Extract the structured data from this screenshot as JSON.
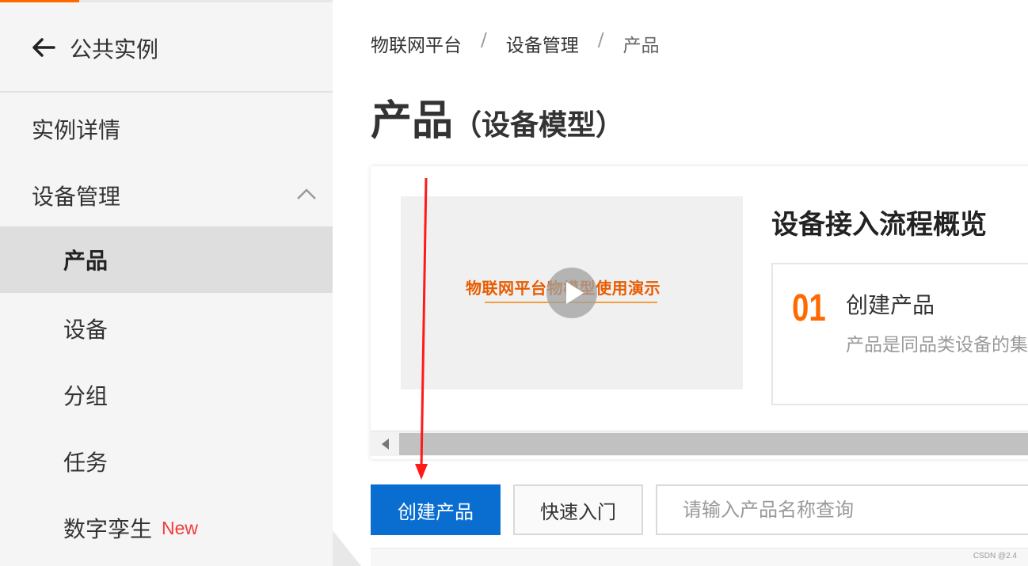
{
  "sidebar": {
    "title": "公共实例",
    "items": [
      {
        "label": "实例详情"
      },
      {
        "label": "设备管理"
      },
      {
        "label": "产品"
      },
      {
        "label": "设备"
      },
      {
        "label": "分组"
      },
      {
        "label": "任务"
      },
      {
        "label": "数字孪生",
        "badge": "New"
      }
    ]
  },
  "breadcrumb": [
    "物联网平台",
    "/",
    "设备管理",
    "/",
    "产品"
  ],
  "page": {
    "title": "产品",
    "subtitle": "（设备模型）"
  },
  "card": {
    "video_text": "物联网平台物模型使用演示",
    "flow_title": "设备接入流程概览",
    "step": {
      "number": "01",
      "name": "创建产品",
      "desc": "产品是同品类设备的集"
    }
  },
  "actions": {
    "create_label": "创建产品",
    "quickstart_label": "快速入门",
    "search_placeholder": "请输入产品名称查询"
  },
  "watermark": "CSDN @2.4",
  "colors": {
    "accent": "#ff6a00",
    "primary": "#0a6ed1",
    "badge": "#f23c3c",
    "annotation_arrow": "#ff1a1a"
  }
}
